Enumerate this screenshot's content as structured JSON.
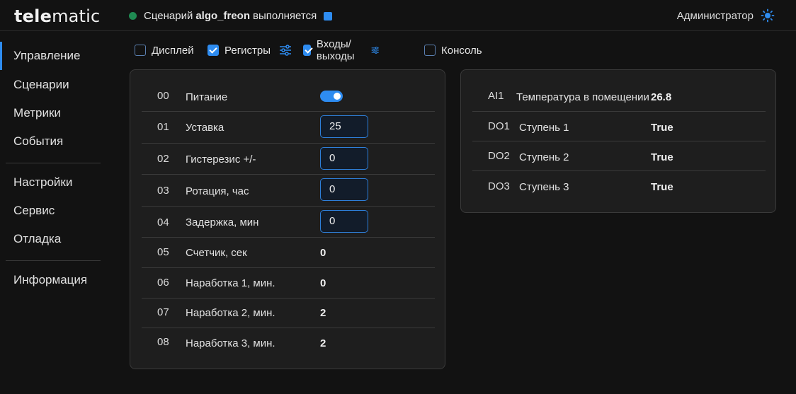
{
  "header": {
    "logo_bold": "tele",
    "logo_rest": "matic",
    "status_prefix": "Сценарий",
    "status_algo": "algo_freon",
    "status_suffix": "выполняется",
    "user": "Администратор",
    "status_color": "#1f8a52",
    "accent": "#2e8cf0",
    "theme_icon": "sun-icon"
  },
  "sidebar": {
    "items": [
      {
        "label": "Управление",
        "active": true
      },
      {
        "label": "Сценарии"
      },
      {
        "label": "Метрики"
      },
      {
        "label": "События"
      },
      {
        "label": "Настройки"
      },
      {
        "label": "Сервис"
      },
      {
        "label": "Отладка"
      },
      {
        "label": "Информация"
      }
    ]
  },
  "toggles": [
    {
      "label": "Дисплей",
      "checked": false
    },
    {
      "label": "Регистры",
      "checked": true,
      "icon": "sliders-icon"
    },
    {
      "label": "Входы/выходы",
      "checked": true,
      "icon": "sliders-icon"
    },
    {
      "label": "Консоль",
      "checked": false
    }
  ],
  "registers": [
    {
      "num": "00",
      "label": "Питание",
      "type": "switch",
      "on": true
    },
    {
      "num": "01",
      "label": "Уставка",
      "type": "input",
      "value": "25"
    },
    {
      "num": "02",
      "label": "Гистерезис +/-",
      "type": "input",
      "value": "0"
    },
    {
      "num": "03",
      "label": "Ротация, час",
      "type": "input",
      "value": "0"
    },
    {
      "num": "04",
      "label": "Задержка, мин",
      "type": "input",
      "value": "0"
    },
    {
      "num": "05",
      "label": "Счетчик, сек",
      "type": "value",
      "value": "0"
    },
    {
      "num": "06",
      "label": "Наработка 1, мин.",
      "type": "value",
      "value": "0"
    },
    {
      "num": "07",
      "label": "Наработка 2, мин.",
      "type": "value",
      "value": "2"
    },
    {
      "num": "08",
      "label": "Наработка 3, мин.",
      "type": "value",
      "value": "2"
    }
  ],
  "io": [
    {
      "id": "AI1",
      "label": "Температура в помещении",
      "value": "26.8"
    },
    {
      "id": "DO1",
      "label": "Ступень 1",
      "value": "True"
    },
    {
      "id": "DO2",
      "label": "Ступень 2",
      "value": "True"
    },
    {
      "id": "DO3",
      "label": "Ступень 3",
      "value": "True"
    }
  ]
}
